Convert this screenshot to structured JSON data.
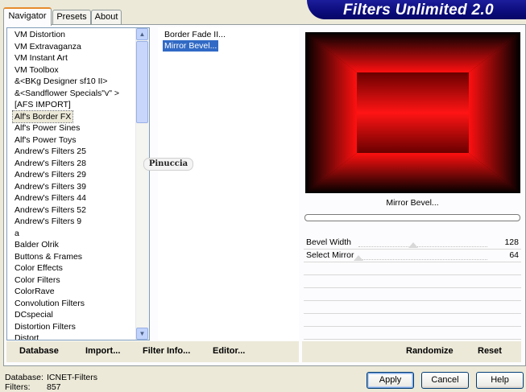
{
  "title_banner": "Filters Unlimited 2.0",
  "tabs": [
    "Navigator",
    "Presets",
    "About"
  ],
  "categories": [
    "VM Distortion",
    "VM Extravaganza",
    "VM Instant Art",
    "VM Toolbox",
    "&<BKg Designer sf10 II>",
    "&<Sandflower Specials\"v\" >",
    "[AFS IMPORT]",
    "Alf's Border FX",
    "Alf's Power Sines",
    "Alf's Power Toys",
    "Andrew's Filters 25",
    "Andrew's Filters 28",
    "Andrew's Filters 29",
    "Andrew's Filters 39",
    "Andrew's Filters 44",
    "Andrew's Filters 52",
    "Andrew's Filters 9",
    "a",
    "Balder Olrik",
    "Buttons & Frames",
    "Color Effects",
    "Color Filters",
    "ColorRave",
    "Convolution Filters",
    "DCspecial",
    "Distortion Filters",
    "Distort"
  ],
  "selected_category": "Alf's Border FX",
  "filters": [
    "Border Fade II...",
    "Mirror Bevel..."
  ],
  "selected_filter": "Mirror Bevel...",
  "watermark": "Pinuccia",
  "preview_filter_name": "Mirror Bevel...",
  "params": [
    {
      "label": "Bevel Width",
      "value": "128",
      "level": 0.5
    },
    {
      "label": "Select Mirror",
      "value": "64",
      "level": 0.0
    }
  ],
  "toolbar": {
    "database": "Database",
    "import": "Import...",
    "filter_info": "Filter Info...",
    "editor": "Editor...",
    "randomize": "Randomize",
    "reset": "Reset"
  },
  "status": {
    "database_label": "Database:",
    "database_value": "ICNET-Filters",
    "filters_label": "Filters:",
    "filters_value": "857"
  },
  "buttons": {
    "apply": "Apply",
    "cancel": "Cancel",
    "help": "Help"
  },
  "colors": {
    "banner": "#0c0c7c",
    "selection": "#316ac5",
    "preview_glow": "#ff0000"
  }
}
